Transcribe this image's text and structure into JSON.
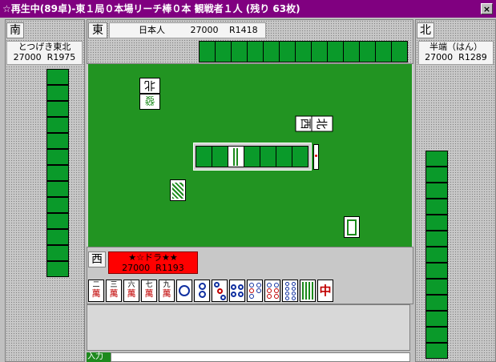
{
  "window": {
    "title": "☆再生中(89卓)-東１局０本場リーチ棒０本 観戦者１人 (残り 63枚)",
    "close_label": "×"
  },
  "seats": {
    "east": {
      "wind": "東",
      "name": "日本人",
      "score": "27000",
      "rating": "R1418"
    },
    "south": {
      "wind": "南",
      "name": "とつげき東北",
      "score": "27000",
      "rating": "R1975"
    },
    "north": {
      "wind": "北",
      "name": "半端（はん）",
      "score": "27000",
      "rating": "R1289"
    },
    "west": {
      "wind": "西",
      "name": "★☆ドラ★★",
      "score": "27000",
      "rating": "R1193"
    }
  },
  "table": {
    "discards": [
      "北",
      "發",
      "西",
      "北"
    ],
    "dora_indicator": "8-bamboo",
    "colors": {
      "felt": "#1e8a1e",
      "tile_back": "#0a9a2a",
      "title_bar": "#800080",
      "west_name_bg": "#ff0000"
    }
  },
  "hand": {
    "tiles": [
      {
        "rank": "二",
        "suit": "萬"
      },
      {
        "rank": "三",
        "suit": "萬"
      },
      {
        "rank": "六",
        "suit": "萬"
      },
      {
        "rank": "七",
        "suit": "萬"
      },
      {
        "rank": "九",
        "suit": "萬"
      },
      {
        "kind": "pin",
        "count": 1
      },
      {
        "kind": "pin",
        "count": 2
      },
      {
        "kind": "pin",
        "count": 3
      },
      {
        "kind": "pin",
        "count": 4
      },
      {
        "kind": "pin",
        "count": 5
      },
      {
        "kind": "pin",
        "count": 6
      },
      {
        "kind": "pin",
        "count": 8
      },
      {
        "kind": "sou",
        "count": 8
      },
      {
        "rank": "中",
        "kind": "dragon"
      }
    ]
  },
  "input": {
    "label": "入力",
    "value": ""
  }
}
